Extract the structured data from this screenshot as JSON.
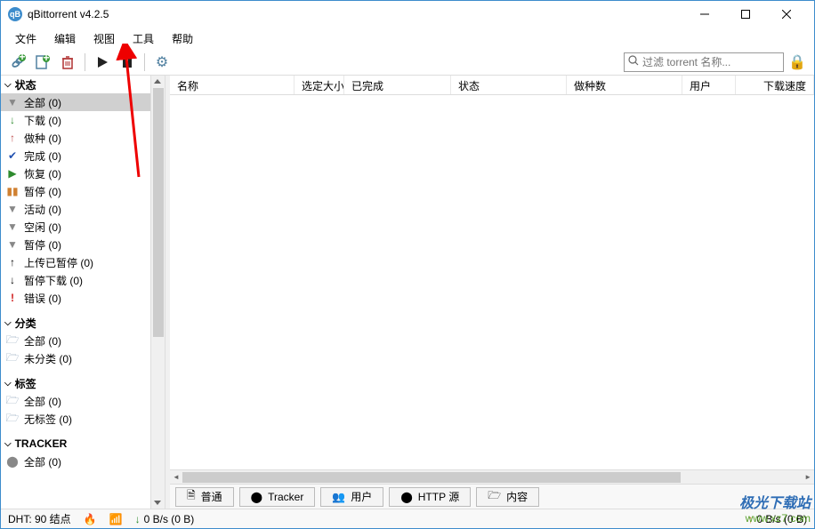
{
  "window": {
    "title": "qBittorrent v4.2.5"
  },
  "menu": {
    "file": "文件",
    "edit": "编辑",
    "view": "视图",
    "tools": "工具",
    "help": "帮助"
  },
  "search": {
    "placeholder": "过滤 torrent 名称..."
  },
  "sidebar": {
    "status": {
      "title": "状态",
      "items": [
        {
          "label": "全部 (0)"
        },
        {
          "label": "下载 (0)"
        },
        {
          "label": "做种 (0)"
        },
        {
          "label": "完成 (0)"
        },
        {
          "label": "恢复 (0)"
        },
        {
          "label": "暂停 (0)"
        },
        {
          "label": "活动 (0)"
        },
        {
          "label": "空闲 (0)"
        },
        {
          "label": "暂停 (0)"
        },
        {
          "label": "上传已暂停 (0)"
        },
        {
          "label": "暂停下载 (0)"
        },
        {
          "label": "错误 (0)"
        }
      ]
    },
    "category": {
      "title": "分类",
      "items": [
        {
          "label": "全部 (0)"
        },
        {
          "label": "未分类 (0)"
        }
      ]
    },
    "tag": {
      "title": "标签",
      "items": [
        {
          "label": "全部 (0)"
        },
        {
          "label": "无标签 (0)"
        }
      ]
    },
    "tracker": {
      "title": "TRACKER",
      "items": [
        {
          "label": "全部 (0)"
        }
      ]
    }
  },
  "columns": {
    "name": "名称",
    "size": "选定大小",
    "done": "已完成",
    "status": "状态",
    "seeds": "做种数",
    "peers": "用户",
    "dlspeed": "下载速度"
  },
  "tabs": {
    "general": "普通",
    "tracker": "Tracker",
    "peers": "用户",
    "http": "HTTP 源",
    "content": "内容"
  },
  "status": {
    "dht": "DHT: 90 结点",
    "dl": "0 B/s (0 B)",
    "ul": "0 B/s (0 B)"
  },
  "watermark": {
    "line1": "极光下载站",
    "line2": "www.xz7.com"
  }
}
